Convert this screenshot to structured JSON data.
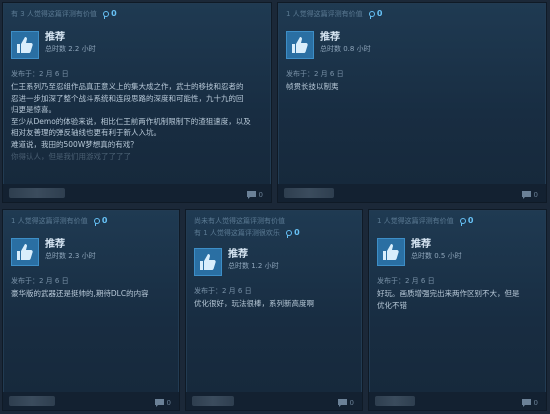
{
  "reviews": [
    {
      "helpful": "有 3 人觉得这篇评测有价值",
      "award_count": "0",
      "recommend": "推荐",
      "hours": "总时数 2.2 小时",
      "posted": "发布于：2 月 6 日",
      "lines": [
        "仁王系列乃至忍组作品真正意义上的集大成之作，武士的移技和忍者的",
        "忍进一步加深了整个战斗系统和连段思路的深度和可能性，九十九的回",
        "归更是惊喜。",
        "至少从Demo的体验来说，相比仁王前两作机制限制下的渣狙速度，以及",
        "相对友善理的弹反轴线也更有利于新人入坑。",
        "难道说，我田的500W梦想真的有戏？",
        "你得认人，但是我们用游戏了了了了"
      ],
      "comments": "0"
    },
    {
      "helpful": "1 人觉得这篇评测有价值",
      "award_count": "0",
      "recommend": "推荐",
      "hours": "总时数 0.8 小时",
      "posted": "发布于：2 月 6 日",
      "lines": [
        "帧贯长技以制夷"
      ],
      "comments": "0"
    },
    {
      "helpful": "1 人觉得这篇评测有价值",
      "award_count": "0",
      "recommend": "推荐",
      "hours": "总时数 2.3 小时",
      "posted": "发布于：2 月 6 日",
      "lines": [
        "豪华版的武器还是挺帅的,期待DLC的内容"
      ],
      "comments": "0"
    },
    {
      "helpful": "尚未有人觉得这篇评测有价值",
      "helpful2": "有 1 人觉得这篇评测很欢乐",
      "award_count": "0",
      "recommend": "推荐",
      "hours": "总时数 1.2 小时",
      "posted": "发布于：2 月 6 日",
      "lines": [
        "优化很好，玩法很棒，系列新高度啊"
      ],
      "comments": "0"
    },
    {
      "helpful": "1 人觉得这篇评测有价值",
      "award_count": "0",
      "recommend": "推荐",
      "hours": "总时数 0.5 小时",
      "posted": "发布于：2 月 6 日",
      "lines": [
        "好玩。画质增强完出来两作区别不大，但是",
        "优化不错"
      ],
      "comments": "0"
    }
  ]
}
